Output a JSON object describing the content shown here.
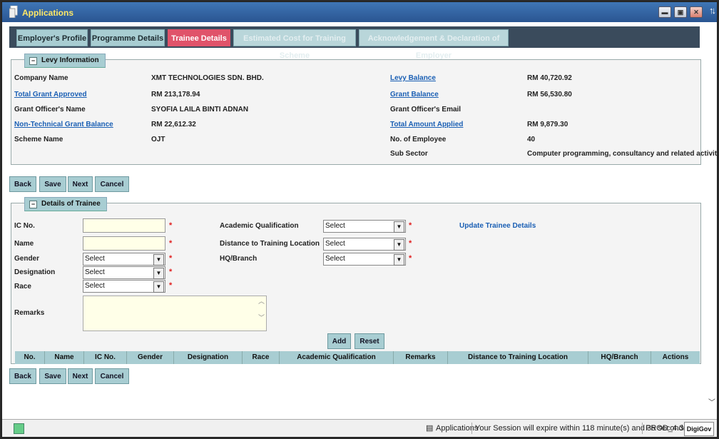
{
  "window": {
    "title": "Applications"
  },
  "tabs": [
    {
      "label": "Employer's Profile",
      "state": "normal"
    },
    {
      "label": "Programme Details",
      "state": "normal"
    },
    {
      "label": "Trainee Details",
      "state": "active"
    },
    {
      "label": "Estimated Cost for Training Scheme",
      "state": "disabled"
    },
    {
      "label": "Acknowledgement & Declaration of Employer",
      "state": "disabled"
    }
  ],
  "levy": {
    "legend": "Levy Information",
    "company_name_label": "Company Name",
    "company_name": "XMT TECHNOLOGIES SDN. BHD.",
    "total_grant_label": "Total Grant Approved",
    "total_grant": "RM 213,178.94",
    "officer_name_label": "Grant Officer's Name",
    "officer_name": "SYOFIA LAILA BINTI ADNAN",
    "nontech_label": "Non-Technical Grant Balance",
    "nontech": "RM 22,612.32",
    "scheme_label": "Scheme Name",
    "scheme": "OJT",
    "levy_balance_label": "Levy Balance",
    "levy_balance": "RM 40,720.92",
    "grant_balance_label": "Grant Balance",
    "grant_balance": "RM 56,530.80",
    "officer_email_label": "Grant Officer's Email",
    "total_applied_label": "Total Amount Applied",
    "total_applied": "RM 9,879.30",
    "employees_label": "No. of Employee",
    "employees": "40",
    "subsector_label": "Sub Sector",
    "subsector": "Computer programming, consultancy and related activities"
  },
  "buttons": {
    "back": "Back",
    "save": "Save",
    "next": "Next",
    "cancel": "Cancel",
    "add": "Add",
    "reset": "Reset"
  },
  "trainee": {
    "legend": "Details of Trainee",
    "ic_label": "IC No.",
    "name_label": "Name",
    "gender_label": "Gender",
    "designation_label": "Designation",
    "race_label": "Race",
    "remarks_label": "Remarks",
    "academic_label": "Academic Qualification",
    "distance_label": "Distance to Training Location",
    "hq_label": "HQ/Branch",
    "update_link": "Update Trainee Details",
    "select_text": "Select",
    "required_mark": "*"
  },
  "table": {
    "headers": [
      "No.",
      "Name",
      "IC No.",
      "Gender",
      "Designation",
      "Race",
      "Academic Qualification",
      "Remarks",
      "Distance to Training Location",
      "HQ/Branch",
      "Actions"
    ]
  },
  "status": {
    "app": "Applications",
    "session": "Your Session will expire within 118 minute(s) and 35 second(s)",
    "version": "PROD_4.36.0",
    "logo": "DigiGov"
  },
  "colors": {
    "titlebar": "#2f62a4",
    "tab_active": "#e0536a",
    "tab_normal": "#a8cdd2",
    "link": "#1a5fb4",
    "required": "#e02020"
  }
}
